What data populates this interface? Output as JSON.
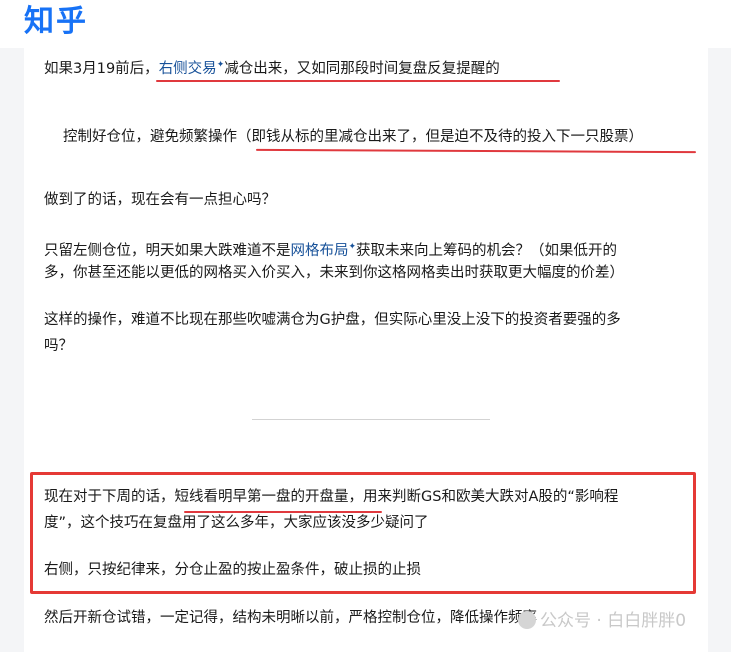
{
  "header": {
    "logo": "知乎"
  },
  "article": {
    "line1": {
      "a": "如果3月19前后，",
      "b": "右侧交易",
      "c": "减仓出来，又如同那段时间复盘反复提醒的"
    },
    "line2": {
      "a": "控制好仓位，避免频繁操作",
      "b": "（即钱从标的里减仓出来了，但是迫不及待的投入下一只股票）"
    },
    "line3": "做到了的话，现在会有一点担心吗？",
    "line4": {
      "a": "只留左侧仓位，明天如果大跌难道不是",
      "b": "网格布局",
      "c": "获取未来向上筹码的机会？（如果低开的"
    },
    "line5": "多，你甚至还能以更低的网格买入价买入，未来到你这格网格卖出时获取更大幅度的价差）",
    "line6": "这样的操作，难道不比现在那些吹嘘满仓为G护盘，但实际心里没上没下的投资者要强的多",
    "line7": "吗？",
    "box_line1": {
      "a": "现在对于下周的话，",
      "b": "短线看明早第一盘的开盘量",
      "c": "，用来判断GS和欧美大跌对A股的“影响程"
    },
    "box_line2": "度”，这个技巧在复盘用了这么多年，大家应该没多少疑问了",
    "box_line3": "右侧，只按纪律来，分仓止盈的按止盈条件，破止损的止损",
    "line8": "然后开新仓试错，一定记得，结构未明晰以前，严格控制仓位，降低操作频率"
  },
  "spark_glyph": "✦",
  "watermark": {
    "text": "公众号 · 白白胖胖0"
  }
}
